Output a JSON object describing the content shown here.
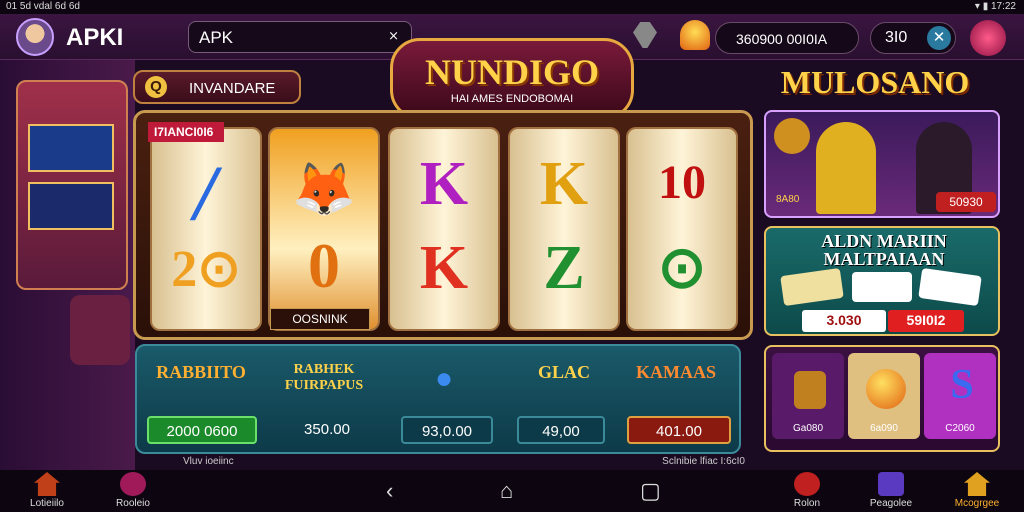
{
  "statusbar": {
    "left": "01 5d vdal 6d 6d",
    "right": "▾ ▮ 17:22"
  },
  "topbar": {
    "app_label": "APKI",
    "search_text": "APK",
    "search_clear": "⨯",
    "balance": "360900 00I0IA",
    "level": "3I0",
    "level_icon": "✕"
  },
  "badge": {
    "text": "INVANDARE",
    "q": "Q"
  },
  "logo": {
    "title": "NUNDIGO",
    "subtitle": "HAI AMES ENDOBOMAI"
  },
  "reels": {
    "ribbon": "I7IANCI0I6",
    "caption": "OOSNINK",
    "symbols": [
      {
        "top": "╱",
        "bottom": "2⊙"
      },
      {
        "top": "🦊",
        "bottom": "0"
      },
      {
        "top": "K",
        "bottom": "K"
      },
      {
        "top": "K",
        "bottom": "Z"
      },
      {
        "top": "10",
        "bottom": "⊙"
      }
    ]
  },
  "categories": [
    {
      "name": "RABBIITO",
      "value": "2000 0600",
      "style": "green"
    },
    {
      "name": "RABHEK FUIRPAPUS",
      "value": "350.00",
      "style": "plain"
    },
    {
      "name": "●",
      "value": "93,0.00",
      "style": "teal"
    },
    {
      "name": "GLAC",
      "value": "49,00",
      "style": "teal"
    },
    {
      "name": "KAMAAS",
      "value": "401.00",
      "style": "red"
    }
  ],
  "right": {
    "title": "MULOSANO",
    "card1": {
      "value": "50930",
      "left": "8A80"
    },
    "card2": {
      "title": "ALDN MARIIN MALTPAIAAN",
      "value1": "3.030",
      "value2": "59I0I2"
    },
    "card3": {
      "labels": [
        "Ga080",
        "6a090",
        "C2060"
      ]
    }
  },
  "ticker": {
    "left": "Vluv ioeiinc",
    "right": "Sclnibie lfiac I:6cI0"
  },
  "nav": {
    "items": [
      {
        "label": "Lotieiilo",
        "icon": "home-icon"
      },
      {
        "label": "Rooleio",
        "icon": "star-icon"
      },
      {
        "label": "Rolon",
        "icon": "no-icon"
      },
      {
        "label": "Peagolee",
        "icon": "gift-icon"
      },
      {
        "label": "Mcogrgee",
        "icon": "house-icon"
      }
    ],
    "system": {
      "back": "‹",
      "home": "⌂",
      "recent": "▢"
    }
  },
  "colors": {
    "gold": "#ffd24a",
    "accent": "#c01a3a",
    "teal": "#1a5a6a"
  }
}
